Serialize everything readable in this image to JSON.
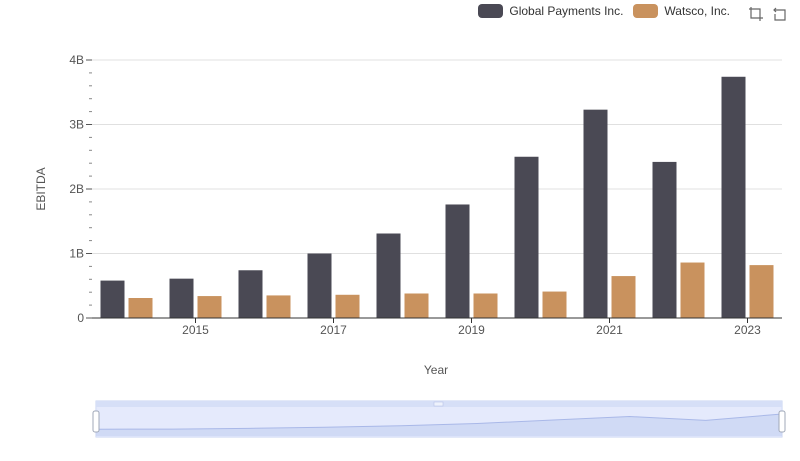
{
  "colors": {
    "global": "#4a4954",
    "watsco": "#c9925e",
    "slider_fill": "#dbe3fb",
    "slider_border": "#c7d3f2"
  },
  "legend": [
    {
      "label": "Global Payments Inc.",
      "color": "#4a4954"
    },
    {
      "label": "Watsco, Inc.",
      "color": "#c9925e"
    }
  ],
  "toolbox": {
    "icons": [
      "zoom-icon",
      "restore-icon"
    ]
  },
  "chart_data": {
    "type": "bar",
    "xlabel": "Year",
    "ylabel": "EBITDA",
    "ylim": [
      0,
      4000000000
    ],
    "yticks": [
      "0",
      "1B",
      "2B",
      "3B",
      "4B"
    ],
    "categories": [
      "2014",
      "2015",
      "2016",
      "2017",
      "2018",
      "2019",
      "2020",
      "2021",
      "2022",
      "2023"
    ],
    "xtick_labels": [
      "2015",
      "2017",
      "2019",
      "2021",
      "2023"
    ],
    "grid": true,
    "legend_position": "top-right",
    "series": [
      {
        "name": "Global Payments Inc.",
        "values": [
          580000000,
          610000000,
          740000000,
          1000000000,
          1310000000,
          1760000000,
          2500000000,
          3230000000,
          2420000000,
          3740000000
        ]
      },
      {
        "name": "Watsco, Inc.",
        "values": [
          310000000,
          340000000,
          350000000,
          360000000,
          380000000,
          380000000,
          410000000,
          650000000,
          860000000,
          820000000
        ]
      }
    ]
  }
}
